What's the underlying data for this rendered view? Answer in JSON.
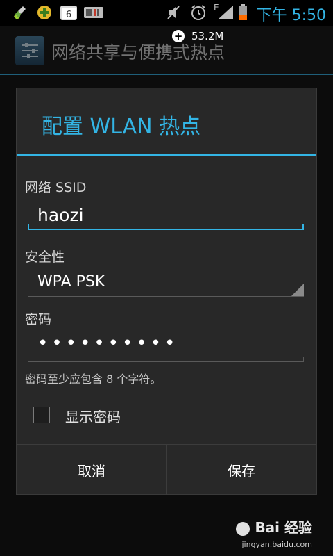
{
  "status_bar": {
    "time": "下午 5:50",
    "network_type": "E",
    "icons": [
      "broom-icon",
      "plus-badge-icon",
      "calendar-icon",
      "sim-card-icon",
      "mute-icon",
      "alarm-icon",
      "signal-icon",
      "battery-icon"
    ],
    "calendar_day": "6"
  },
  "floating_memory": {
    "value": "53.2M"
  },
  "action_bar": {
    "title": "网络共享与便携式热点"
  },
  "dialog": {
    "title": "配置 WLAN 热点",
    "ssid": {
      "label": "网络 SSID",
      "value": "haozi"
    },
    "security": {
      "label": "安全性",
      "value": "WPA PSK"
    },
    "password": {
      "label": "密码",
      "value": "••••••••••"
    },
    "hint": "密码至少应包含 8 个字符。",
    "show_password": {
      "label": "显示密码",
      "checked": false
    },
    "buttons": {
      "cancel": "取消",
      "save": "保存"
    }
  },
  "watermark": {
    "brand": "Bai 经验",
    "url": "jingyan.baidu.com"
  },
  "colors": {
    "accent": "#33b5e5",
    "dialog_bg": "#282828",
    "background": "#0c0c0c"
  }
}
